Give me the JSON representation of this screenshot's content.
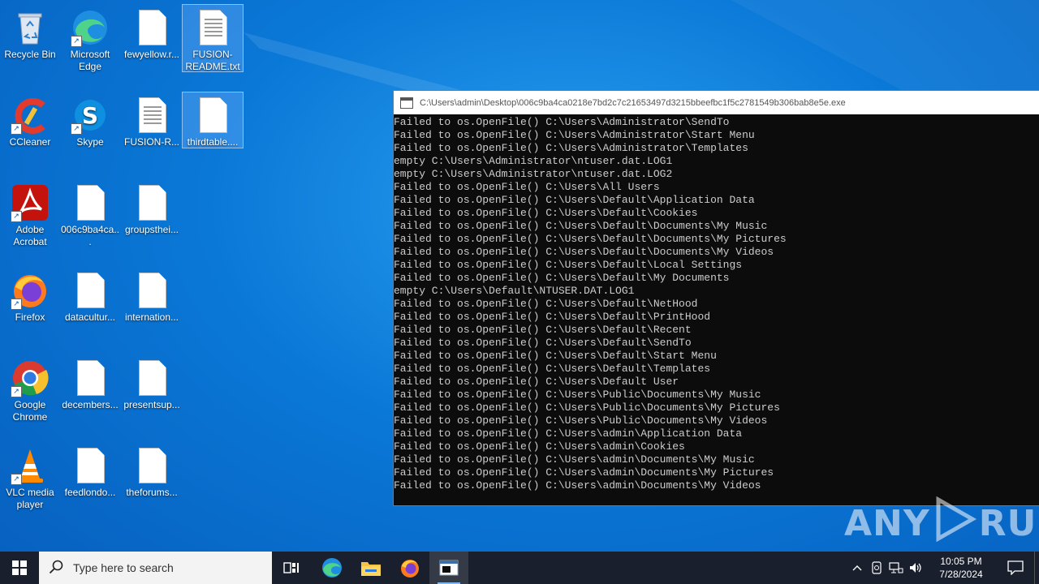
{
  "desktop": {
    "icons": [
      {
        "label": "Recycle Bin"
      },
      {
        "label": "Microsoft Edge"
      },
      {
        "label": "fewyellow.r..."
      },
      {
        "label": "FUSION-README.txt"
      },
      {
        "label": "CCleaner"
      },
      {
        "label": "Skype"
      },
      {
        "label": "FUSION-R..."
      },
      {
        "label": "thirdtable...."
      },
      {
        "label": "Adobe Acrobat"
      },
      {
        "label": "006c9ba4ca..."
      },
      {
        "label": "groupsthei..."
      },
      {
        "label": "Firefox"
      },
      {
        "label": "datacultur..."
      },
      {
        "label": "internation..."
      },
      {
        "label": "Google Chrome"
      },
      {
        "label": "decembers..."
      },
      {
        "label": "presentsup..."
      },
      {
        "label": "VLC media player"
      },
      {
        "label": "feedlondo..."
      },
      {
        "label": "theforums..."
      }
    ]
  },
  "console": {
    "title": "C:\\Users\\admin\\Desktop\\006c9ba4ca0218e7bd2c7c21653497d3215bbeefbc1f5c2781549b306bab8e5e.exe",
    "lines": [
      "Failed to os.OpenFile() C:\\Users\\Administrator\\SendTo",
      "Failed to os.OpenFile() C:\\Users\\Administrator\\Start Menu",
      "Failed to os.OpenFile() C:\\Users\\Administrator\\Templates",
      "empty C:\\Users\\Administrator\\ntuser.dat.LOG1",
      "empty C:\\Users\\Administrator\\ntuser.dat.LOG2",
      "Failed to os.OpenFile() C:\\Users\\All Users",
      "Failed to os.OpenFile() C:\\Users\\Default\\Application Data",
      "Failed to os.OpenFile() C:\\Users\\Default\\Cookies",
      "Failed to os.OpenFile() C:\\Users\\Default\\Documents\\My Music",
      "Failed to os.OpenFile() C:\\Users\\Default\\Documents\\My Pictures",
      "Failed to os.OpenFile() C:\\Users\\Default\\Documents\\My Videos",
      "Failed to os.OpenFile() C:\\Users\\Default\\Local Settings",
      "Failed to os.OpenFile() C:\\Users\\Default\\My Documents",
      "empty C:\\Users\\Default\\NTUSER.DAT.LOG1",
      "Failed to os.OpenFile() C:\\Users\\Default\\NetHood",
      "Failed to os.OpenFile() C:\\Users\\Default\\PrintHood",
      "Failed to os.OpenFile() C:\\Users\\Default\\Recent",
      "Failed to os.OpenFile() C:\\Users\\Default\\SendTo",
      "Failed to os.OpenFile() C:\\Users\\Default\\Start Menu",
      "Failed to os.OpenFile() C:\\Users\\Default\\Templates",
      "Failed to os.OpenFile() C:\\Users\\Default User",
      "Failed to os.OpenFile() C:\\Users\\Public\\Documents\\My Music",
      "Failed to os.OpenFile() C:\\Users\\Public\\Documents\\My Pictures",
      "Failed to os.OpenFile() C:\\Users\\Public\\Documents\\My Videos",
      "Failed to os.OpenFile() C:\\Users\\admin\\Application Data",
      "Failed to os.OpenFile() C:\\Users\\admin\\Cookies",
      "Failed to os.OpenFile() C:\\Users\\admin\\Documents\\My Music",
      "Failed to os.OpenFile() C:\\Users\\admin\\Documents\\My Pictures",
      "Failed to os.OpenFile() C:\\Users\\admin\\Documents\\My Videos"
    ]
  },
  "watermark": {
    "left": "ANY",
    "right": "RUN"
  },
  "taskbar": {
    "search_placeholder": "Type here to search",
    "apps": [
      "task-view",
      "edge",
      "file-explorer",
      "firefox",
      "console"
    ],
    "time": "10:05 PM",
    "date": "7/28/2024"
  },
  "colors": {
    "accent": "#0a78d7",
    "taskbar": "#1a1f2e",
    "console_bg": "#0c0c0c"
  }
}
